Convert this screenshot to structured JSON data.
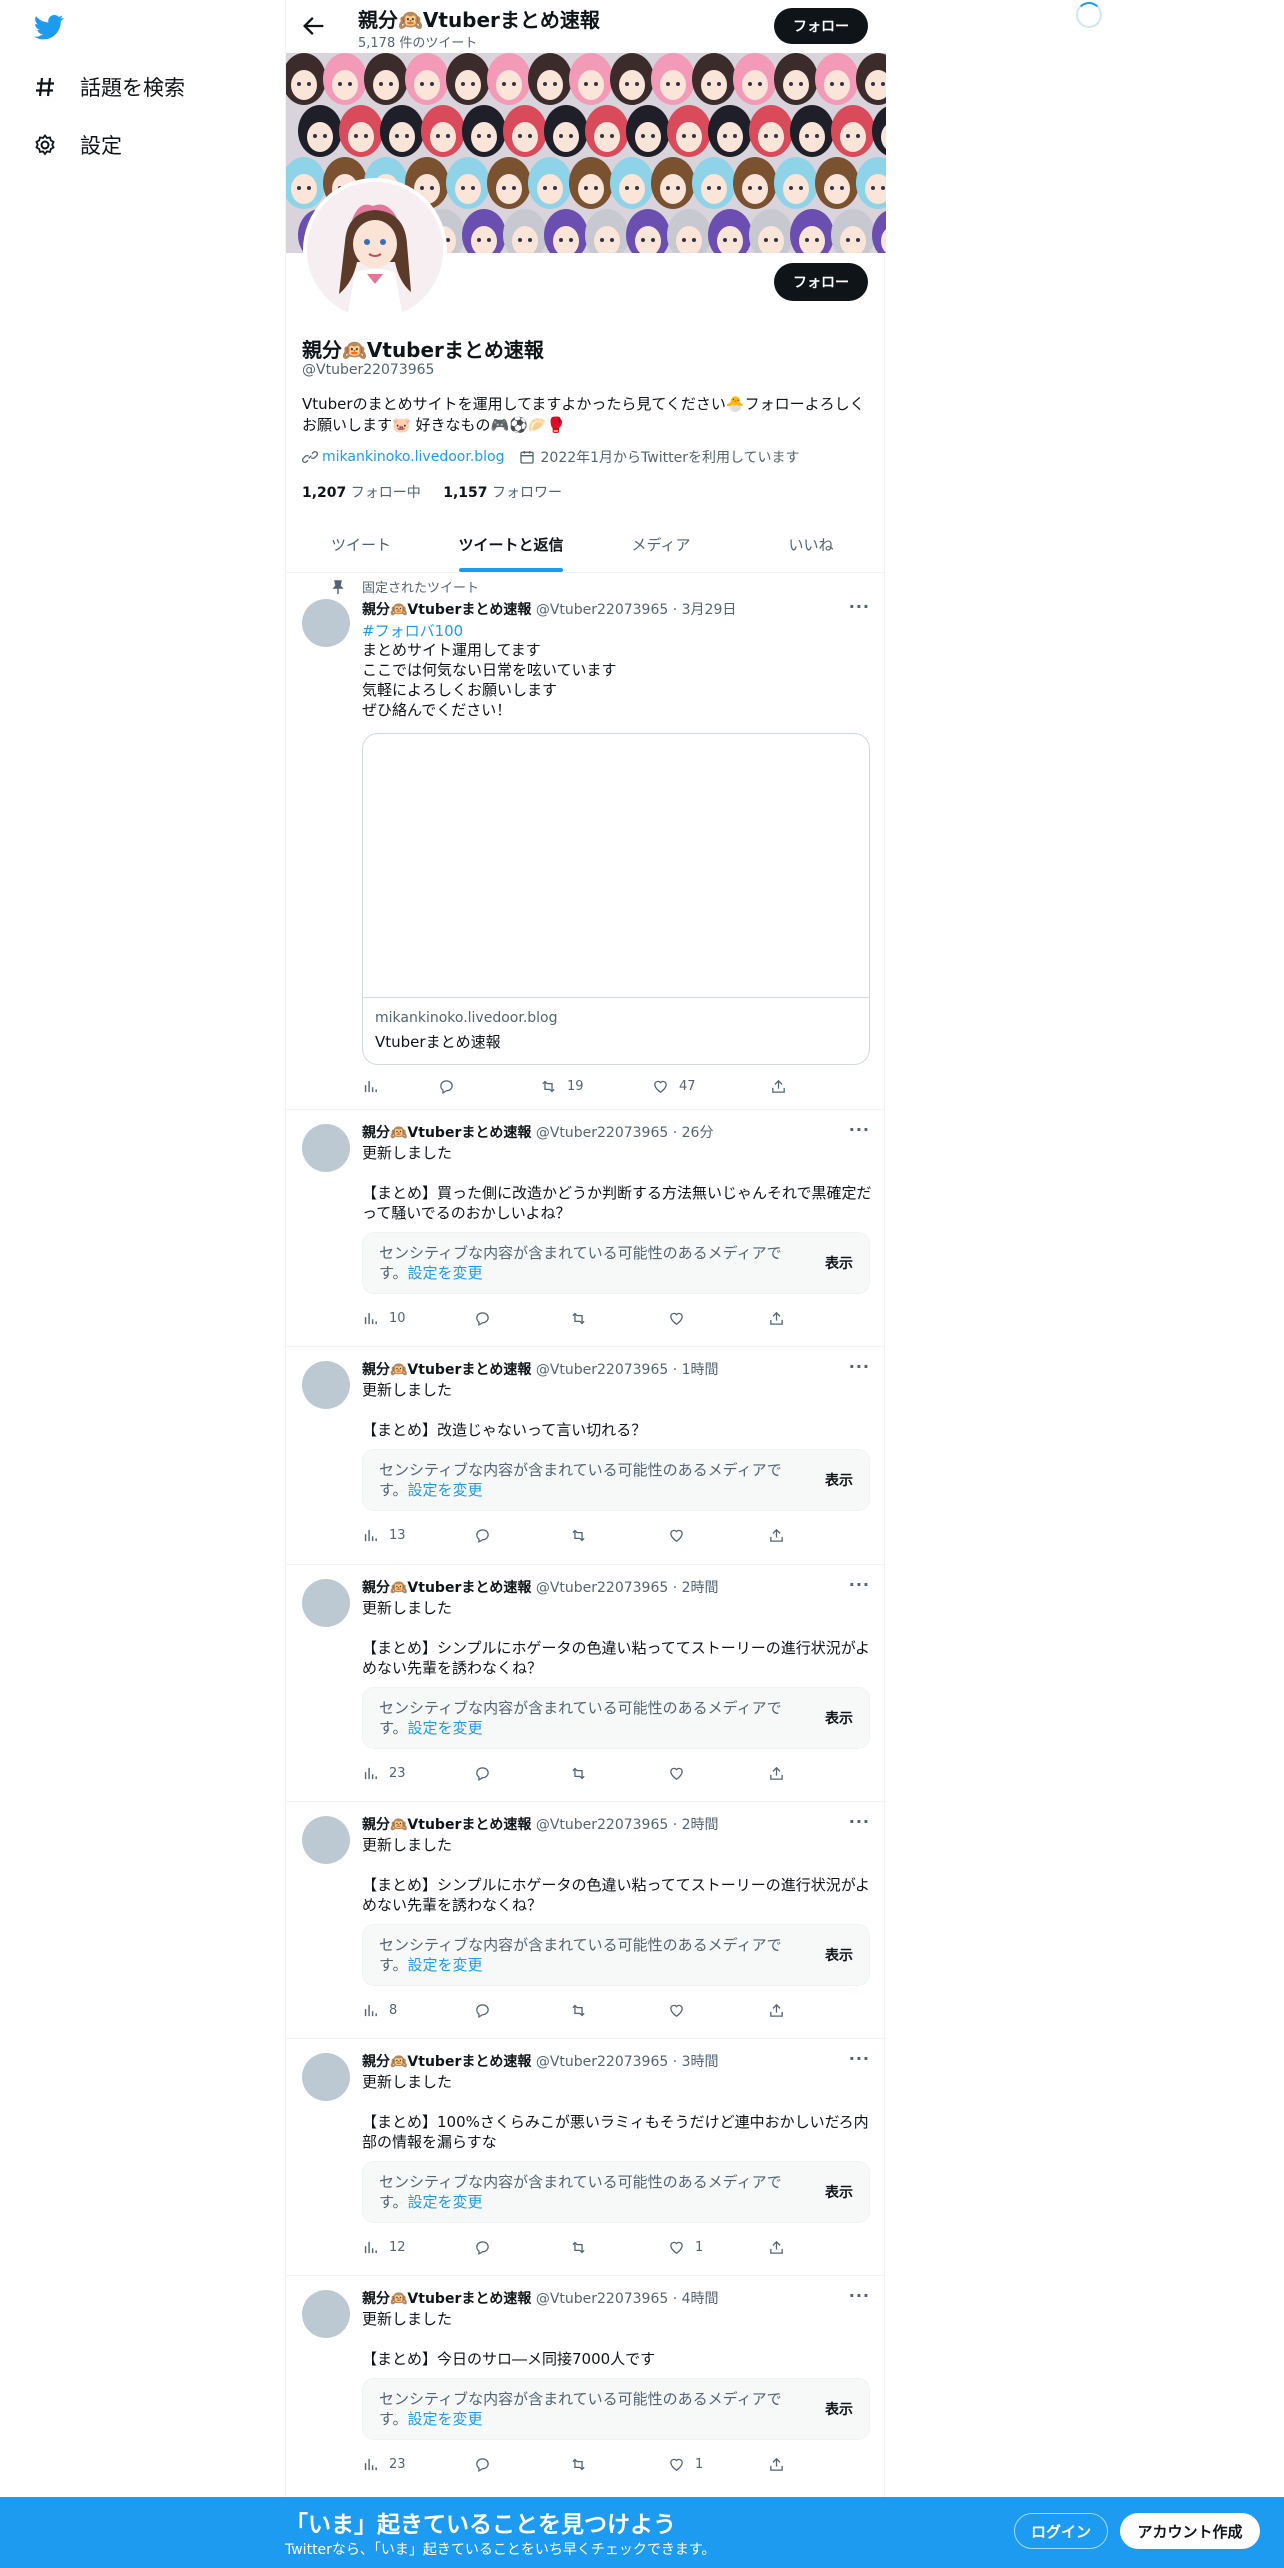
{
  "nav": {
    "explore": "話題を検索",
    "settings": "設定"
  },
  "header": {
    "title": "親分🙉Vtuberまとめ速報",
    "tweet_count": "5,178 件のツイート",
    "follow": "フォロー"
  },
  "profile": {
    "name": "親分🙉Vtuberまとめ速報",
    "handle": "@Vtuber22073965",
    "follow": "フォロー",
    "bio": "Vtuberのまとめサイトを運用してますよかったら見てください🐣フォローよろしくお願いします🐷 好きなもの🎮⚽🥟🥊",
    "link": "mikankinoko.livedoor.blog",
    "joined": "2022年1月からTwitterを利用しています",
    "following_count": "1,207",
    "following_label": "フォロー中",
    "followers_count": "1,157",
    "followers_label": "フォロワー"
  },
  "tabs": [
    "ツイート",
    "ツイートと返信",
    "メディア",
    "いいね"
  ],
  "pinned_label": "固定されたツイート",
  "sensitive": {
    "msg": "センシティブな内容が含まれている可能性のあるメディアです。",
    "settings": "設定を変更",
    "show": "表示"
  },
  "tweets": [
    {
      "name": "親分🙉Vtuberまとめ速報",
      "handle": "@Vtuber22073965",
      "time": "3月29日",
      "hashtag": "#フォロバ100",
      "text": "まとめサイト運用してます\nここでは何気ない日常を呟いています\n気軽によろしくお願いします\nぜひ絡んでください！",
      "card_domain": "mikankinoko.livedoor.blog",
      "card_title": "Vtuberまとめ速報",
      "views": "",
      "replies": "",
      "retweets": "19",
      "likes": "47"
    },
    {
      "name": "親分🙉Vtuberまとめ速報",
      "handle": "@Vtuber22073965",
      "time": "26分",
      "text": "更新しました\n\n【まとめ】買った側に改造かどうか判断する方法無いじゃんそれで黒確定だって騒いでるのおかしいよね？",
      "views": "10",
      "likes": ""
    },
    {
      "name": "親分🙉Vtuberまとめ速報",
      "handle": "@Vtuber22073965",
      "time": "1時間",
      "text": "更新しました\n\n【まとめ】改造じゃないって言い切れる？",
      "views": "13",
      "likes": ""
    },
    {
      "name": "親分🙉Vtuberまとめ速報",
      "handle": "@Vtuber22073965",
      "time": "2時間",
      "text": "更新しました\n\n【まとめ】シンプルにホゲータの色違い粘っててストーリーの進行状況がよめない先輩を誘わなくね？",
      "views": "23",
      "likes": ""
    },
    {
      "name": "親分🙉Vtuberまとめ速報",
      "handle": "@Vtuber22073965",
      "time": "2時間",
      "text": "更新しました\n\n【まとめ】シンプルにホゲータの色違い粘っててストーリーの進行状況がよめない先輩を誘わなくね？",
      "views": "8",
      "likes": ""
    },
    {
      "name": "親分🙉Vtuberまとめ速報",
      "handle": "@Vtuber22073965",
      "time": "3時間",
      "text": "更新しました\n\n【まとめ】100%さくらみこが悪いラミィもそうだけど連中おかしいだろ内部の情報を漏らすな",
      "views": "12",
      "likes": "1"
    },
    {
      "name": "親分🙉Vtuberまとめ速報",
      "handle": "@Vtuber22073965",
      "time": "4時間",
      "text": "更新しました\n\n【まとめ】今日のサロ―メ同接7000人です",
      "views": "23",
      "likes": "1"
    }
  ],
  "bottom_bar": {
    "title": "「いま」起きていることを見つけよう",
    "subtitle": "Twitterなら、「いま」起きていることをいち早くチェックできます。",
    "login": "ログイン",
    "signup": "アカウント作成"
  },
  "colors": {
    "accent": "#1d9bf0",
    "text": "#0f1419",
    "muted": "#536471"
  }
}
